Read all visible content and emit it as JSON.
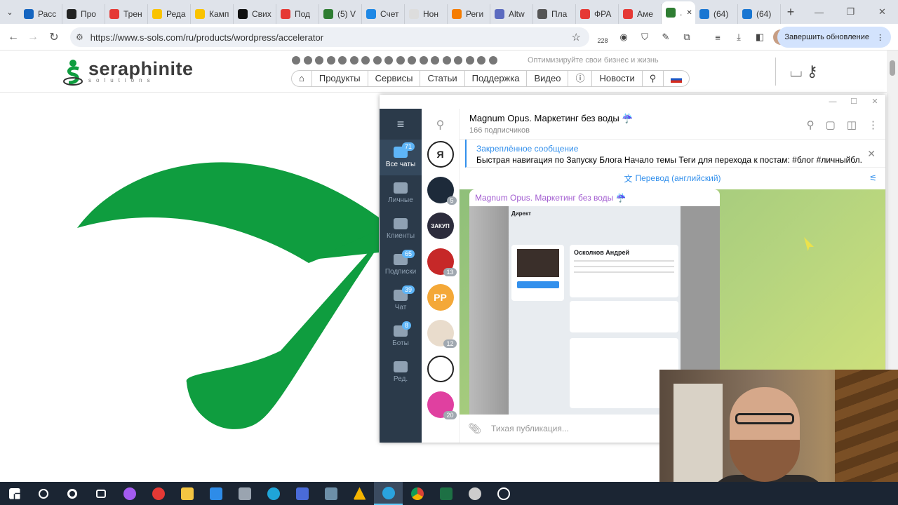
{
  "browser": {
    "tabs": [
      {
        "label": "Расс",
        "color": "#1565c0"
      },
      {
        "label": "Про",
        "color": "#222222"
      },
      {
        "label": "Трен",
        "color": "#e53935"
      },
      {
        "label": "Реда",
        "color": "#f9c300"
      },
      {
        "label": "Камп",
        "color": "#f9c300"
      },
      {
        "label": "Свих",
        "color": "#111111"
      },
      {
        "label": "Под",
        "color": "#e53935"
      },
      {
        "label": "(5) V",
        "color": "#2e7d32"
      },
      {
        "label": "Счет",
        "color": "#1e88e5"
      },
      {
        "label": "Нон",
        "color": "#dddddd"
      },
      {
        "label": "Реги",
        "color": "#f57c00"
      },
      {
        "label": "Altw",
        "color": "#5c6bc0"
      },
      {
        "label": "Пла",
        "color": "#555555"
      },
      {
        "label": "ФРА",
        "color": "#e53935"
      },
      {
        "label": "Аме",
        "color": "#e53935"
      },
      {
        "label": ".",
        "color": "#2e7d32"
      },
      {
        "label": "(64)",
        "color": "#1976d2"
      },
      {
        "label": "(64)",
        "color": "#1976d2"
      }
    ],
    "active_tab_index": 15,
    "url": "https://www.s-sols.com/ru/products/wordpress/accelerator",
    "ext_badge": "228",
    "update_button": "Завершить обновление"
  },
  "site": {
    "logo_name": "seraphinite",
    "logo_sub": "solutions",
    "tagline": "Оптимизируйте свои бизнес и жизнь",
    "menu": [
      "Продукты",
      "Сервисы",
      "Статьи",
      "Поддержка",
      "Видео",
      "Новости"
    ],
    "brand_color": "#0f9d3f"
  },
  "telegram": {
    "folders": [
      {
        "label": "Все чаты",
        "badge": "71"
      },
      {
        "label": "Личные",
        "badge": ""
      },
      {
        "label": "Клиенты",
        "badge": ""
      },
      {
        "label": "Подписки",
        "badge": "65"
      },
      {
        "label": "Чат",
        "badge": "39"
      },
      {
        "label": "Боты",
        "badge": "8"
      },
      {
        "label": "Ред.",
        "badge": ""
      }
    ],
    "chats": [
      {
        "initials": "Я",
        "color": "#ffffff",
        "count": ""
      },
      {
        "initials": "",
        "color": "#1d2a3a",
        "count": "5"
      },
      {
        "initials": "ЗАКУП",
        "color": "#2c2c3c",
        "count": ""
      },
      {
        "initials": "",
        "color": "#c62828",
        "count": "13"
      },
      {
        "initials": "PP",
        "color": "#f4a838",
        "count": ""
      },
      {
        "initials": "",
        "color": "#e9dccc",
        "count": "12"
      },
      {
        "initials": "",
        "color": "#ffffff",
        "count": ""
      },
      {
        "initials": "",
        "color": "#e040a0",
        "count": "20"
      }
    ],
    "channel_title": "Magnum Opus. Маркетинг без воды ☔",
    "subscribers": "166 подписчиков",
    "pinned_label": "Закреплённое сообщение",
    "pinned_text": "Быстрая навигация по Запуску Блога  Начало темы  Теги для перехода к постам:  #блог #личныйбл...",
    "translate": "Перевод (английский)",
    "post_author": "Magnum Opus. Маркетинг без воды ☔",
    "screenshot_brand": "Директ",
    "screenshot_person": "Осколков Андрей",
    "composer_placeholder": "Тихая публикация..."
  }
}
